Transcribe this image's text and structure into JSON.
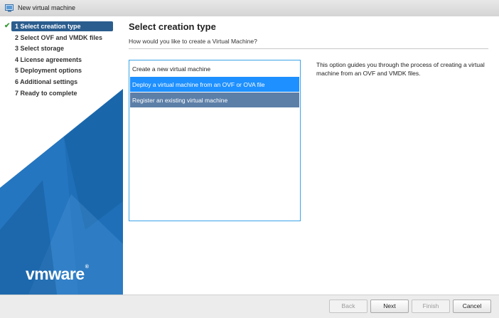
{
  "window": {
    "title": "New virtual machine"
  },
  "sidebar": {
    "steps": [
      {
        "label": "1 Select creation type",
        "active": true,
        "completed": true
      },
      {
        "label": "2 Select OVF and VMDK files"
      },
      {
        "label": "3 Select storage"
      },
      {
        "label": "4 License agreements"
      },
      {
        "label": "5 Deployment options"
      },
      {
        "label": "6 Additional settings"
      },
      {
        "label": "7 Ready to complete"
      }
    ],
    "logo": {
      "brand_a": "vm",
      "brand_b": "ware",
      "reg": "®"
    }
  },
  "main": {
    "title": "Select creation type",
    "subtitle": "How would you like to create a Virtual Machine?",
    "options": [
      {
        "label": "Create a new virtual machine",
        "state": "normal"
      },
      {
        "label": "Deploy a virtual machine from an OVF or OVA file",
        "state": "selected"
      },
      {
        "label": "Register an existing virtual machine",
        "state": "hover"
      }
    ],
    "description": "This option guides you through the process of creating a virtual machine from an OVF and VMDK files."
  },
  "footer": {
    "back": "Back",
    "next": "Next",
    "finish": "Finish",
    "cancel": "Cancel"
  },
  "colors": {
    "sidebar_blue": "#1f6fb8",
    "selected_option": "#1e90ff",
    "hover_option": "#5c7fa8",
    "active_step": "#2b5d8e"
  }
}
